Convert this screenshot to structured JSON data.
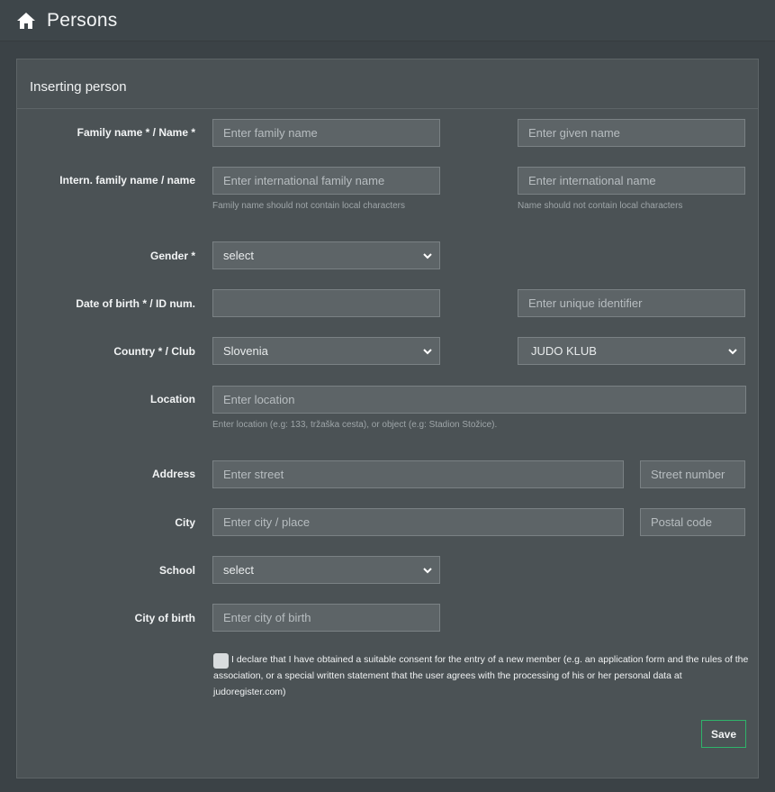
{
  "header": {
    "title": "Persons"
  },
  "panel": {
    "title": "Inserting person"
  },
  "form": {
    "labels": {
      "name": "Family name * / Name *",
      "intern_name": "Intern. family name / name",
      "gender": "Gender *",
      "dob": "Date of birth * / ID num.",
      "country": "Country * / Club",
      "location": "Location",
      "address": "Address",
      "city": "City",
      "school": "School",
      "city_of_birth": "City of birth"
    },
    "placeholders": {
      "family_name": "Enter family name",
      "given_name": "Enter given name",
      "intl_family_name": "Enter international family name",
      "intl_name": "Enter international name",
      "unique_id": "Enter unique identifier",
      "location": "Enter location",
      "street": "Enter street",
      "street_number": "Street number",
      "city": "Enter city / place",
      "postal_code": "Postal code",
      "city_of_birth": "Enter city of birth"
    },
    "values": {
      "gender": "select",
      "country": "Slovenia",
      "club": "JUDO KLUB",
      "school": "select",
      "dob": ""
    },
    "help": {
      "family_name": "Family name should not contain local characters",
      "name": "Name should not contain local characters",
      "location": "Enter location (e.g: 133, tržaška cesta), or object (e.g: Stadion Stožice)."
    },
    "consent": "I declare that I have obtained a suitable consent for the entry of a new member (e.g. an application form and the rules of the association, or a special written statement that the user agrees with the processing of his or her personal data at judoregister.com)",
    "save_label": "Save"
  },
  "icons": {
    "home": "home-icon",
    "dropdown": "chevron-down-icon"
  },
  "colors": {
    "accent": "#2fb36a",
    "background": "#3b4246",
    "panel": "#4b5255",
    "input": "#5d6467"
  }
}
